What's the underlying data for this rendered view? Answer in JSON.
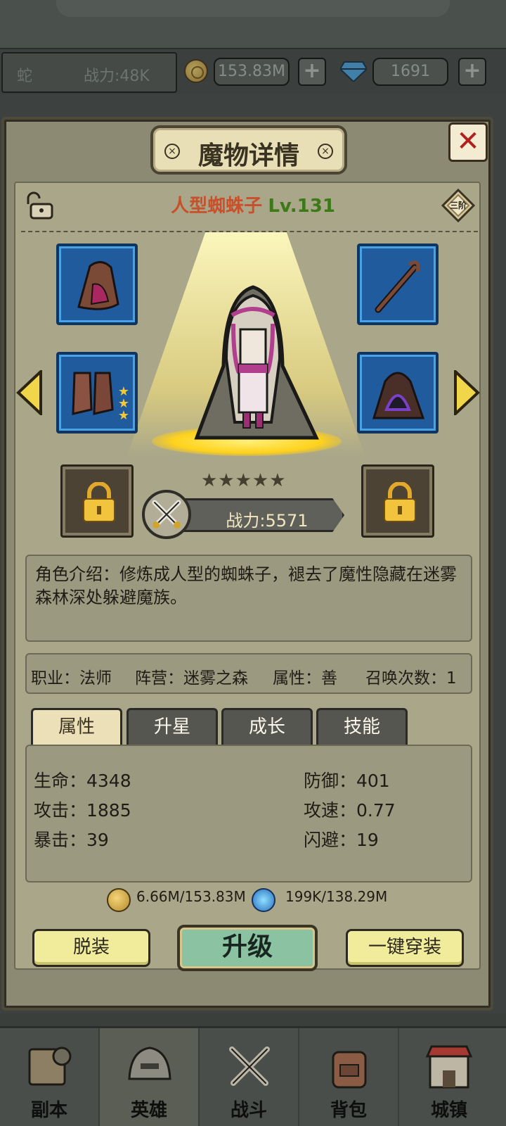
{
  "topbar": {
    "nickname": "蛇",
    "power": "战力:48K",
    "gold": "153.83M",
    "gem": "1691"
  },
  "dialog": {
    "title": "魔物详情",
    "close_label": "✕",
    "rank": "三阶",
    "hero_name": "人型蜘蛛子",
    "hero_level": "Lv.131",
    "power": "战力:5571",
    "stars": "★★★★★",
    "description": "角色介绍：修炼成人型的蜘蛛子，褪去了魔性隐藏在迷雾森林深处躲避魔族。",
    "info": {
      "job": "职业：法师",
      "camp": "阵营：迷雾之森",
      "attribute": "属性：善",
      "summons": "召唤次数：1"
    },
    "tabs": [
      "属性",
      "升星",
      "成长",
      "技能"
    ],
    "stats": {
      "hp": "生命：4348",
      "def": "防御：401",
      "atk": "攻击：1885",
      "aspd": "攻速：0.77",
      "crit": "暴击：39",
      "dodge": "闪避：19"
    },
    "cost_gold": "6.66M/153.83M",
    "cost_exp": "199K/138.29M",
    "buttons": {
      "unequip": "脱装",
      "upgrade": "升级",
      "equip_all": "一键穿装"
    }
  },
  "nav": [
    {
      "label": "副本",
      "icon": "map-icon"
    },
    {
      "label": "英雄",
      "icon": "helmet-icon"
    },
    {
      "label": "战斗",
      "icon": "swords-icon"
    },
    {
      "label": "背包",
      "icon": "backpack-icon"
    },
    {
      "label": "城镇",
      "icon": "town-icon"
    }
  ],
  "colors": {
    "name": "#c8502a",
    "level": "#3c7a17",
    "slot_blue": "#1f5b9d",
    "button_yellow": "#f0ec9b",
    "button_green": "#8bc3a2"
  }
}
